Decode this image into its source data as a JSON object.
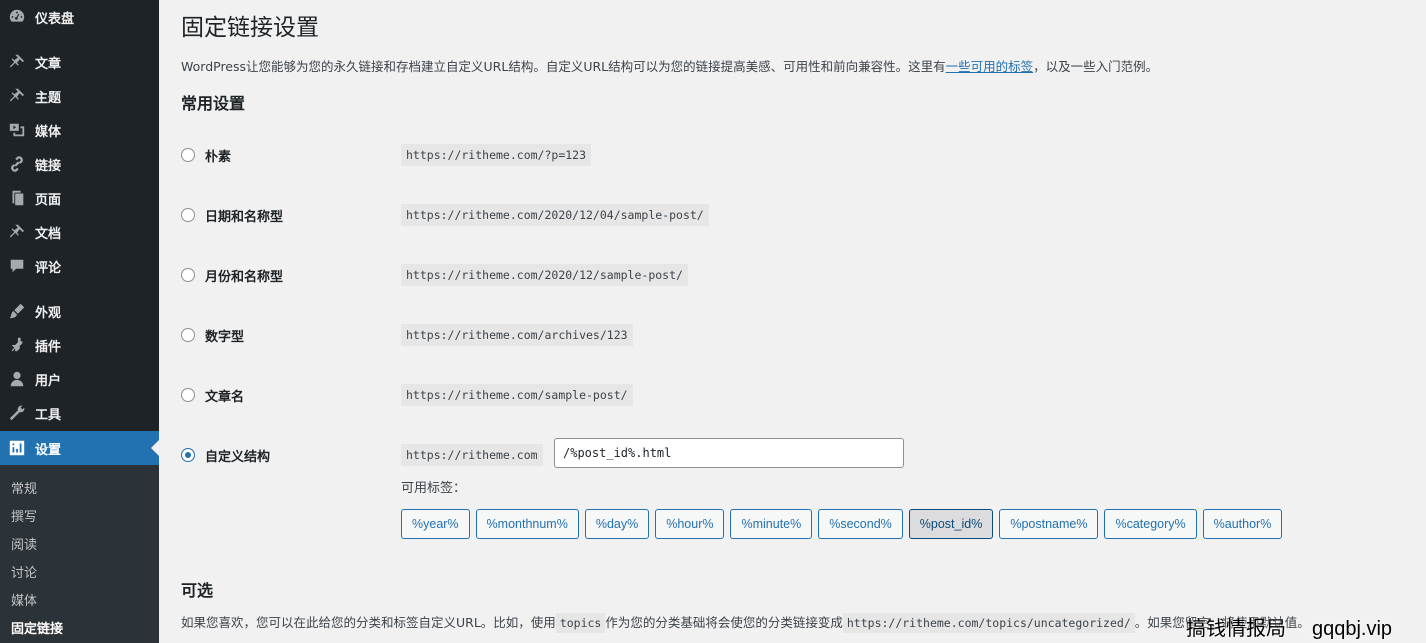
{
  "sidebar": {
    "items": [
      {
        "label": "仪表盘",
        "icon": "dashboard-icon"
      },
      {
        "label": "文章",
        "icon": "pin-icon"
      },
      {
        "label": "主题",
        "icon": "pin-icon"
      },
      {
        "label": "媒体",
        "icon": "media-icon"
      },
      {
        "label": "链接",
        "icon": "link-icon"
      },
      {
        "label": "页面",
        "icon": "page-icon"
      },
      {
        "label": "文档",
        "icon": "pin-icon"
      },
      {
        "label": "评论",
        "icon": "comment-icon"
      },
      {
        "label": "外观",
        "icon": "brush-icon"
      },
      {
        "label": "插件",
        "icon": "plugin-icon"
      },
      {
        "label": "用户",
        "icon": "user-icon"
      },
      {
        "label": "工具",
        "icon": "wrench-icon"
      },
      {
        "label": "设置",
        "icon": "settings-icon"
      }
    ],
    "submenu": [
      "常规",
      "撰写",
      "阅读",
      "讨论",
      "媒体",
      "固定链接"
    ]
  },
  "page": {
    "title": "固定链接设置",
    "intro_before": "WordPress让您能够为您的永久链接和存档建立自定义URL结构。自定义URL结构可以为您的链接提高美感、可用性和前向兼容性。这里有",
    "intro_link": "一些可用的标签",
    "intro_after": "，以及一些入门范例。",
    "common_settings": "常用设置",
    "options": [
      {
        "label": "朴素",
        "url": "https://ritheme.com/?p=123"
      },
      {
        "label": "日期和名称型",
        "url": "https://ritheme.com/2020/12/04/sample-post/"
      },
      {
        "label": "月份和名称型",
        "url": "https://ritheme.com/2020/12/sample-post/"
      },
      {
        "label": "数字型",
        "url": "https://ritheme.com/archives/123"
      },
      {
        "label": "文章名",
        "url": "https://ritheme.com/sample-post/"
      },
      {
        "label": "自定义结构",
        "url": "https://ritheme.com"
      }
    ],
    "selected_option": "自定义结构",
    "custom_structure_value": "/%post_id%.html",
    "available_tags_label": "可用标签：",
    "tags": [
      "%year%",
      "%monthnum%",
      "%day%",
      "%hour%",
      "%minute%",
      "%second%",
      "%post_id%",
      "%postname%",
      "%category%",
      "%author%"
    ],
    "active_tag": "%post_id%",
    "optional_title": "可选",
    "optional_text_1": "如果您喜欢，您可以在此给您的分类和标签自定义URL。比如，使用",
    "optional_code_1": "topics",
    "optional_text_2": "作为您的分类基础将会使您的分类链接变成",
    "optional_code_2": "https://ritheme.com/topics/uncategorized/",
    "optional_text_3": "。如果您留空，将使用默认值。"
  },
  "watermark": {
    "text": "搞钱情报局",
    "domain": "gqqbj.vip"
  },
  "colors": {
    "sidebar": "#1d2327",
    "active": "#2271b1",
    "background": "#f1f1f1"
  }
}
